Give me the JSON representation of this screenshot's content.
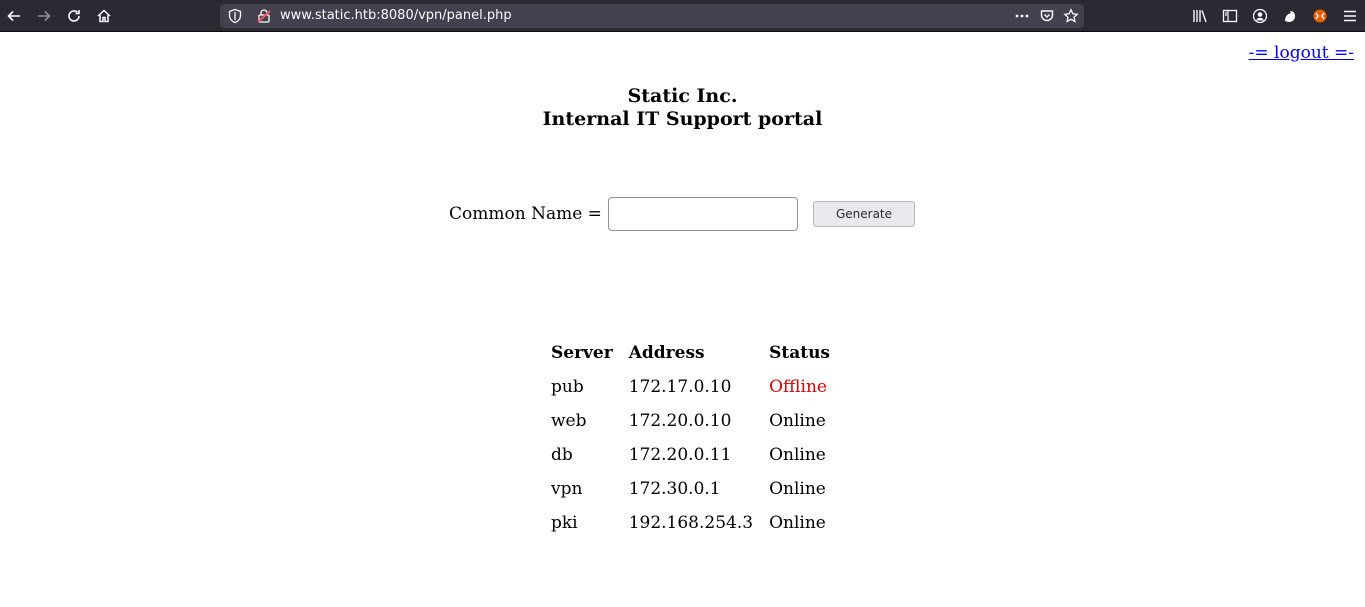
{
  "browser": {
    "url": "www.static.htb:8080/vpn/panel.php"
  },
  "page": {
    "logout_link": "-= logout =-",
    "company": "Static Inc.",
    "subtitle": "Internal IT Support portal",
    "form": {
      "label": "Common Name =",
      "input_value": "",
      "button": "Generate"
    },
    "table": {
      "headers": [
        "Server",
        "Address",
        "Status"
      ],
      "rows": [
        {
          "server": "pub",
          "address": "172.17.0.10",
          "status": "Offline",
          "status_color": "#dd0000"
        },
        {
          "server": "web",
          "address": "172.20.0.10",
          "status": "Online"
        },
        {
          "server": "db",
          "address": "172.20.0.11",
          "status": "Online"
        },
        {
          "server": "vpn",
          "address": "172.30.0.1",
          "status": "Online"
        },
        {
          "server": "pki",
          "address": "192.168.254.3",
          "status": "Online"
        }
      ]
    }
  }
}
